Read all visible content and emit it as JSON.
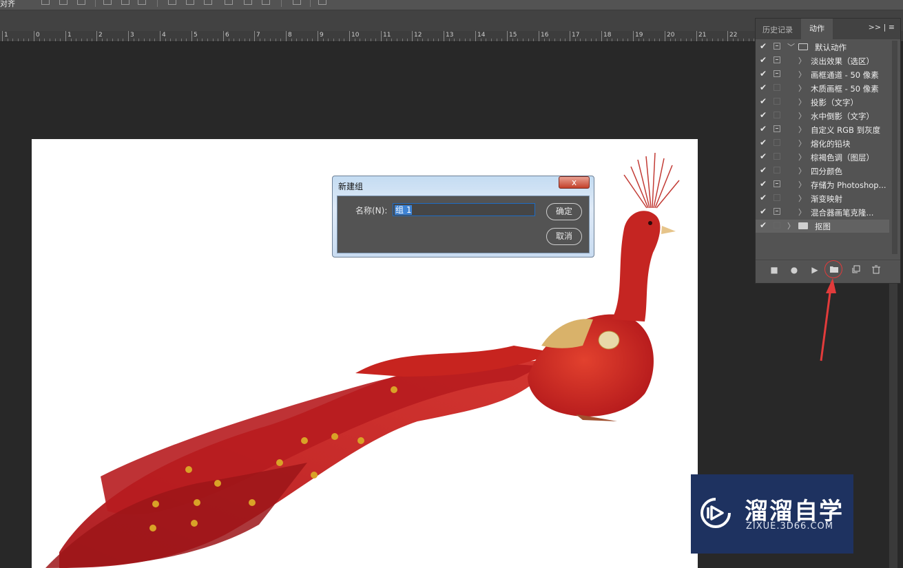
{
  "toolbar": {
    "label": "对齐"
  },
  "ruler": {
    "numbers": [
      "1",
      "0",
      "1",
      "2",
      "3",
      "4",
      "5",
      "6",
      "7",
      "8",
      "9",
      "10",
      "11",
      "12",
      "13",
      "14",
      "15",
      "16",
      "17",
      "18",
      "19",
      "20",
      "21",
      "22"
    ]
  },
  "dialog": {
    "title": "新建组",
    "close": "x",
    "name_label": "名称(N):",
    "name_value": "组 1",
    "ok": "确定",
    "cancel": "取消"
  },
  "panel": {
    "tabs": [
      {
        "label": "历史记录"
      },
      {
        "label": "动作"
      }
    ],
    "menu": ">> | ≡",
    "set_name": "默认动作",
    "actions": [
      {
        "label": "淡出效果（选区）",
        "dialog": true
      },
      {
        "label": "画框通道 - 50 像素",
        "dialog": true
      },
      {
        "label": "木质画框 - 50 像素",
        "dialog": false
      },
      {
        "label": "投影（文字）",
        "dialog": false
      },
      {
        "label": "水中倒影（文字）",
        "dialog": false
      },
      {
        "label": "自定义 RGB 到灰度",
        "dialog": true
      },
      {
        "label": "熔化的铅块",
        "dialog": false
      },
      {
        "label": "棕褐色调（图层）",
        "dialog": false
      },
      {
        "label": "四分颜色",
        "dialog": false
      },
      {
        "label": "存储为 Photoshop...",
        "dialog": true
      },
      {
        "label": "渐变映射",
        "dialog": false
      },
      {
        "label": "混合器画笔克隆...",
        "dialog": true
      }
    ],
    "new_set_name": "抠图",
    "buttons": {
      "stop": "■",
      "record": "●",
      "play": "▶",
      "new_set": "📁",
      "new_action": "⧉",
      "delete": "🗑"
    }
  },
  "watermark": {
    "title": "溜溜自学",
    "subtitle": "ZIXUE.3D66.COM"
  },
  "colors": {
    "accent": "#e23b3b",
    "selection": "#3e83d4",
    "watermark_bg": "#1e3260"
  }
}
